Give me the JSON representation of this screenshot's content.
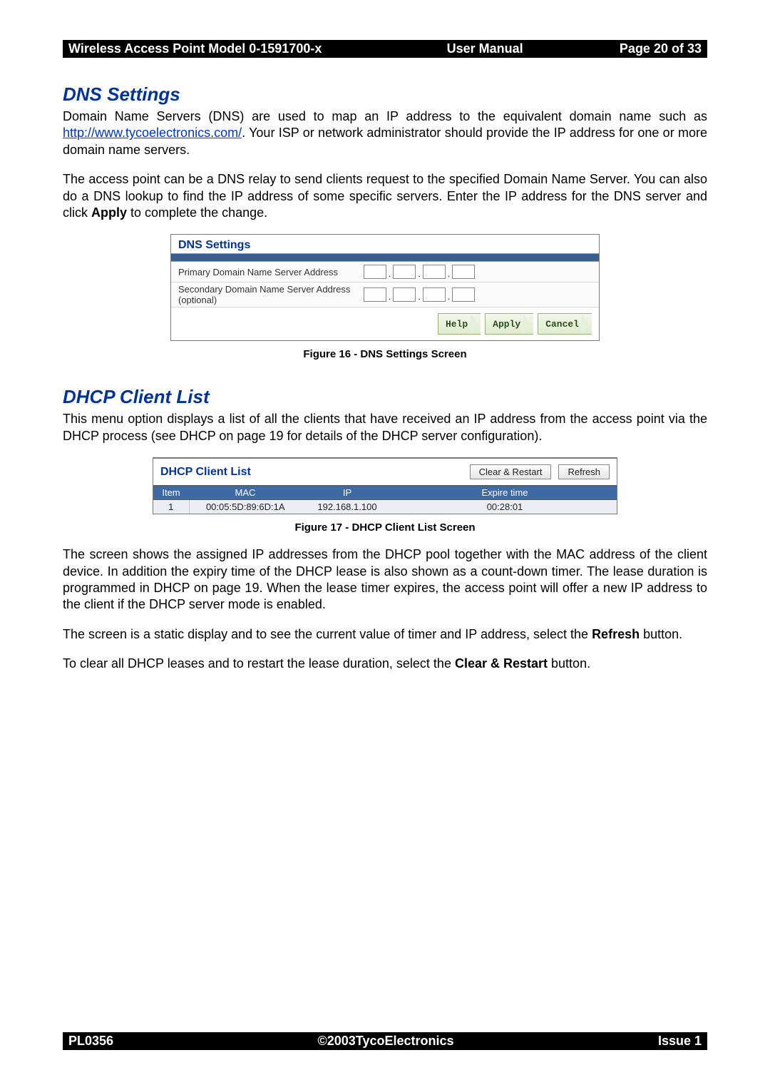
{
  "header": {
    "left": "Wireless Access Point  Model 0-1591700-x",
    "mid": "User Manual",
    "right": "Page 20 of 33"
  },
  "footer": {
    "left": "PL0356",
    "mid": "©2003TycoElectronics",
    "right": "Issue 1"
  },
  "dns_section": {
    "heading": "DNS Settings",
    "para1_pre": "Domain Name Servers (DNS) are used to map an IP address to the equivalent domain name such as ",
    "link": "http://www.tycoelectronics.com/",
    "para1_post": ". Your ISP or network administrator should provide the IP address for one or more domain name servers.",
    "para2_pre": "The access point can be a DNS relay to send clients request to the specified Domain Name Server. You can also do a DNS lookup to find the IP address of some specific servers. Enter the IP address for the DNS server and click ",
    "para2_bold": "Apply",
    "para2_post": " to complete the change.",
    "caption": "Figure 16 - DNS Settings Screen"
  },
  "dns_screen": {
    "title": "DNS Settings",
    "row1_label": "Primary Domain Name Server Address",
    "row2_label": "Secondary Domain Name Server Address (optional)",
    "buttons": {
      "help": "Help",
      "apply": "Apply",
      "cancel": "Cancel"
    }
  },
  "dhcp_section": {
    "heading": "DHCP Client List",
    "para1": "This menu option displays a list of all the clients that have received an IP address from the access point via the DHCP process (see DHCP on page 19 for details of the DHCP server configuration).",
    "caption": "Figure 17 - DHCP Client List Screen",
    "para2": "The screen shows the assigned IP addresses from the DHCP pool together with the MAC address of the client device. In addition the expiry time of the DHCP lease is also shown as a count-down timer. The lease duration is programmed in DHCP on page 19. When the lease timer expires, the access point will offer a new IP address to the client if the DHCP server mode is enabled.",
    "para3_pre": "The screen is a static display and to see the current value of timer and IP address, select the ",
    "para3_bold": "Refresh",
    "para3_post": " button.",
    "para4_pre": "To clear all DHCP leases and to restart the lease duration, select the ",
    "para4_bold": "Clear & Restart",
    "para4_post": " button."
  },
  "dhcp_screen": {
    "title": "DHCP Client List",
    "buttons": {
      "clear": "Clear & Restart",
      "refresh": "Refresh"
    },
    "columns": {
      "item": "Item",
      "mac": "MAC",
      "ip": "IP",
      "expire": "Expire time"
    },
    "rows": [
      {
        "item": "1",
        "mac": "00:05:5D:89:6D:1A",
        "ip": "192.168.1.100",
        "expire": "00:28:01"
      }
    ]
  }
}
